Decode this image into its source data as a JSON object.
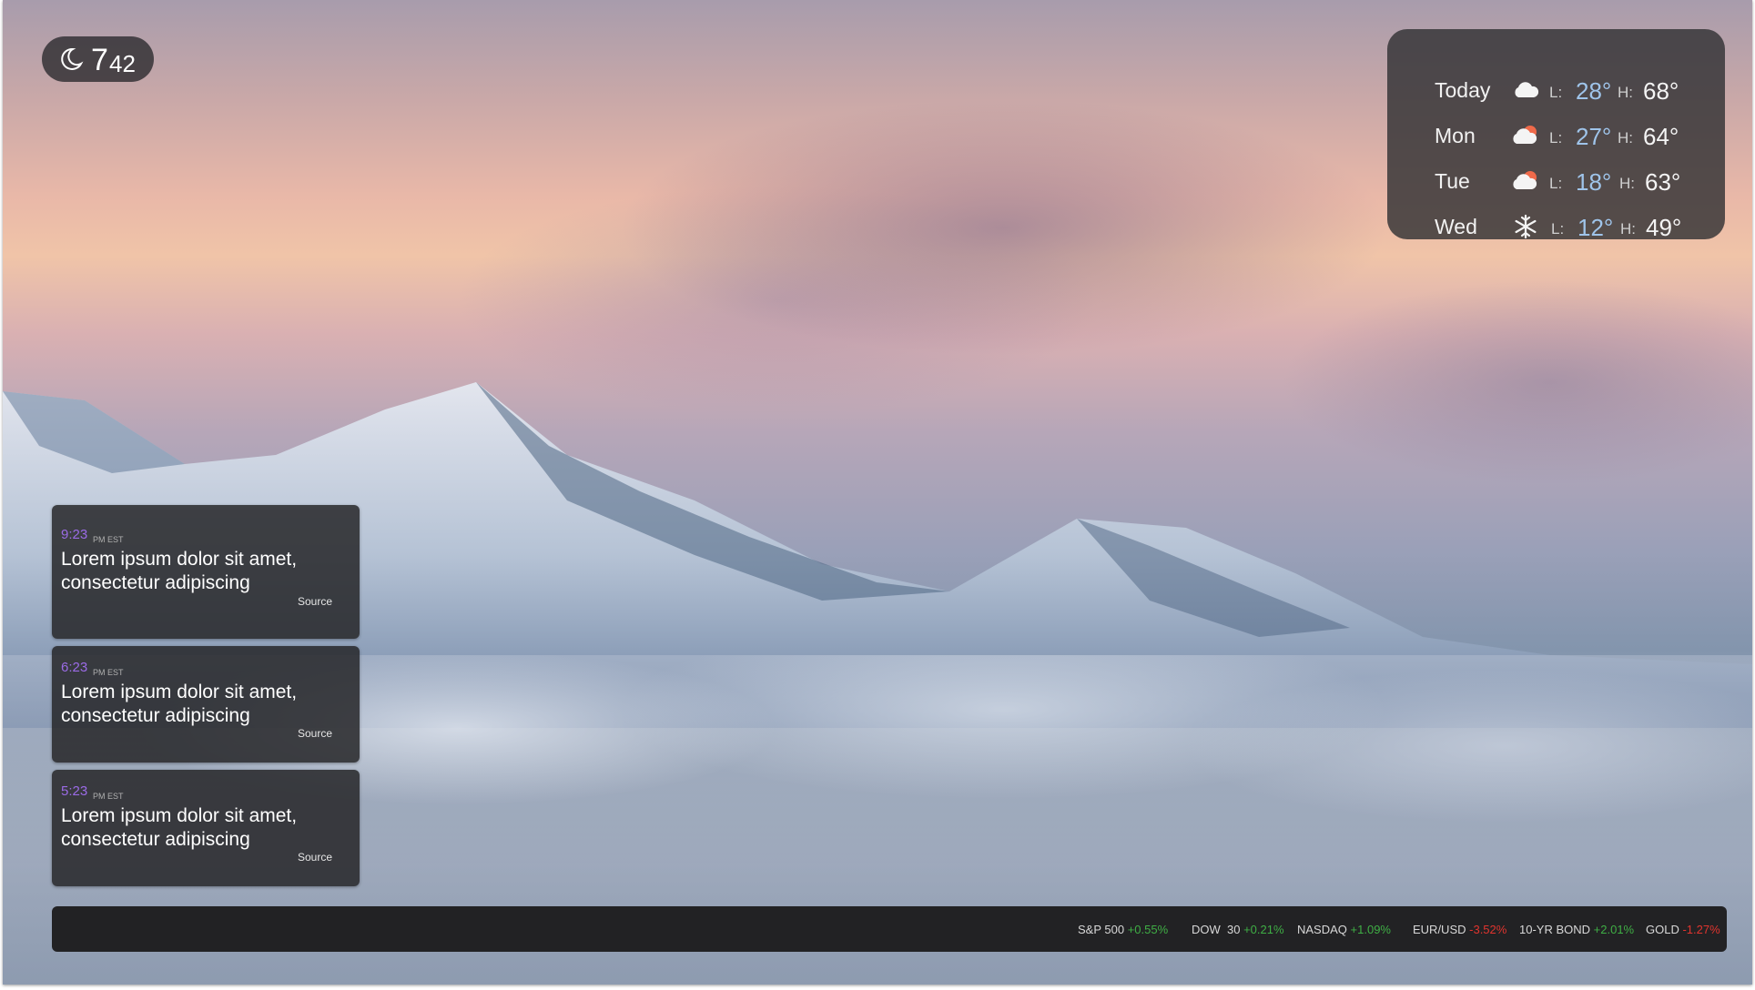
{
  "clock": {
    "hour": "7",
    "minute": "42",
    "icon": "moon-icon"
  },
  "weather": {
    "low_label": "L:",
    "high_label": "H:",
    "days": [
      {
        "day": "Today",
        "icon": "cloud-icon",
        "low": "28°",
        "high": "68°"
      },
      {
        "day": "Mon",
        "icon": "cloud-sun-icon",
        "low": "27°",
        "high": "64°"
      },
      {
        "day": "Tue",
        "icon": "cloud-sun-icon",
        "low": "18°",
        "high": "63°"
      },
      {
        "day": "Wed",
        "icon": "snowflake-icon",
        "low": "12°",
        "high": "49°"
      }
    ]
  },
  "news": [
    {
      "time": "9:23",
      "ampm": "PM EST",
      "headline": "Lorem ipsum dolor sit amet, consectetur adipiscing",
      "source": "Source"
    },
    {
      "time": "6:23",
      "ampm": "PM EST",
      "headline": "Lorem ipsum dolor sit amet, consectetur adipiscing",
      "source": "Source"
    },
    {
      "time": "5:23",
      "ampm": "PM EST",
      "headline": "Lorem ipsum dolor sit amet, consectetur adipiscing",
      "source": "Source"
    }
  ],
  "ticker": [
    {
      "symbol": "S&P 500",
      "change": "+0.55%",
      "direction": "up"
    },
    {
      "symbol": "DOW  30",
      "change": "+0.21%",
      "direction": "up"
    },
    {
      "symbol": "NASDAQ",
      "change": "+1.09%",
      "direction": "up"
    },
    {
      "symbol": "EUR/USD",
      "change": "-3.52%",
      "direction": "down"
    },
    {
      "symbol": "10-YR BOND",
      "change": "+2.01%",
      "direction": "up"
    },
    {
      "symbol": "GOLD",
      "change": "-1.27%",
      "direction": "down"
    }
  ],
  "colors": {
    "accent_time": "#9b6be6",
    "up": "#3fae45",
    "down": "#e0342e",
    "low_temp": "#9fc4ea"
  }
}
